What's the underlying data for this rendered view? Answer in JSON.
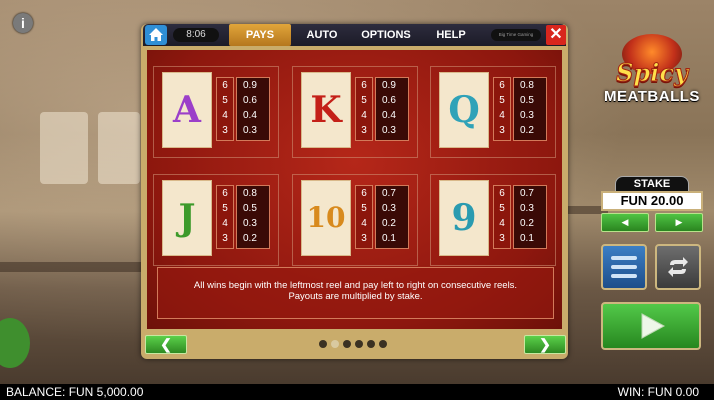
{
  "app": {
    "time": "8:06",
    "maker": "Big Time Gaming"
  },
  "tabs": [
    {
      "label": "PAYS",
      "active": true
    },
    {
      "label": "AUTO",
      "active": false
    },
    {
      "label": "OPTIONS",
      "active": false
    },
    {
      "label": "HELP",
      "active": false
    }
  ],
  "logo": {
    "line1": "Spicy",
    "line2": "MEATBALLS"
  },
  "paytable": [
    {
      "symbol": "A",
      "color": "#9b3fc9",
      "counts": [
        "6",
        "5",
        "4",
        "3"
      ],
      "pays": [
        "0.9",
        "0.6",
        "0.4",
        "0.3"
      ]
    },
    {
      "symbol": "K",
      "color": "#c42018",
      "counts": [
        "6",
        "5",
        "4",
        "3"
      ],
      "pays": [
        "0.9",
        "0.6",
        "0.4",
        "0.3"
      ]
    },
    {
      "symbol": "Q",
      "color": "#2fa2b8",
      "counts": [
        "6",
        "5",
        "4",
        "3"
      ],
      "pays": [
        "0.8",
        "0.5",
        "0.3",
        "0.2"
      ]
    },
    {
      "symbol": "J",
      "color": "#3d9a2a",
      "counts": [
        "6",
        "5",
        "4",
        "3"
      ],
      "pays": [
        "0.8",
        "0.5",
        "0.3",
        "0.2"
      ]
    },
    {
      "symbol": "10",
      "color": "#d88a1d",
      "counts": [
        "6",
        "5",
        "4",
        "3"
      ],
      "pays": [
        "0.7",
        "0.3",
        "0.2",
        "0.1"
      ]
    },
    {
      "symbol": "9",
      "color": "#2a9bb0",
      "counts": [
        "6",
        "5",
        "4",
        "3"
      ],
      "pays": [
        "0.7",
        "0.3",
        "0.2",
        "0.1"
      ]
    }
  ],
  "info": {
    "line1": "All wins begin with the leftmost reel and pay left to right on consecutive reels.",
    "line2": "Payouts are multiplied by stake."
  },
  "pagination": {
    "pages": 6,
    "current": 1
  },
  "stake": {
    "label": "STAKE",
    "value": "FUN 20.00"
  },
  "status": {
    "balance": "BALANCE: FUN 5,000.00",
    "win": "WIN: FUN 0.00"
  },
  "icons": {
    "info": "info-icon",
    "home": "home-icon",
    "close": "close-icon",
    "prev": "chevron-left-icon",
    "next": "chevron-right-icon",
    "menu": "menu-icon",
    "autoplay": "repeat-icon",
    "spin": "play-icon"
  }
}
